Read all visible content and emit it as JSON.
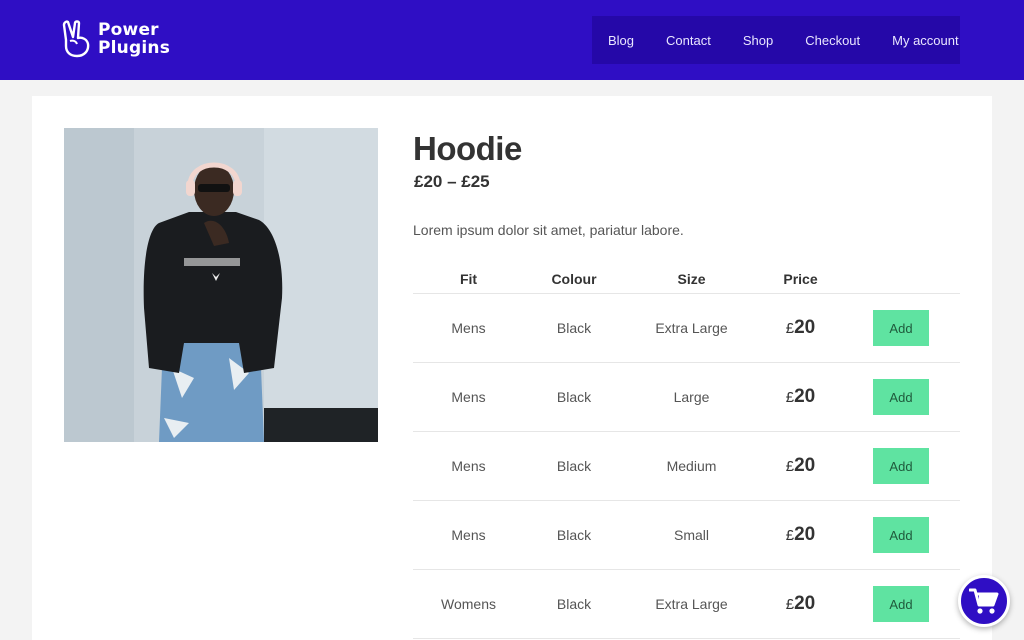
{
  "brand": {
    "line1": "Power",
    "line2": "Plugins"
  },
  "nav": [
    "Blog",
    "Contact",
    "Shop",
    "Checkout",
    "My account"
  ],
  "product": {
    "title": "Hoodie",
    "price_range": "£20 – £25",
    "description": "Lorem ipsum dolor sit amet, pariatur labore.",
    "image_alt": "Model wearing black hoodie"
  },
  "table": {
    "headers": {
      "fit": "Fit",
      "colour": "Colour",
      "size": "Size",
      "price": "Price"
    },
    "rows": [
      {
        "fit": "Mens",
        "colour": "Black",
        "size": "Extra Large",
        "currency": "£",
        "price": "20",
        "action": "Add"
      },
      {
        "fit": "Mens",
        "colour": "Black",
        "size": "Large",
        "currency": "£",
        "price": "20",
        "action": "Add"
      },
      {
        "fit": "Mens",
        "colour": "Black",
        "size": "Medium",
        "currency": "£",
        "price": "20",
        "action": "Add"
      },
      {
        "fit": "Mens",
        "colour": "Black",
        "size": "Small",
        "currency": "£",
        "price": "20",
        "action": "Add"
      },
      {
        "fit": "Womens",
        "colour": "Black",
        "size": "Extra Large",
        "currency": "£",
        "price": "20",
        "action": "Add"
      }
    ]
  },
  "icons": {
    "logo": "peace-hand-icon",
    "cart": "shopping-cart-icon"
  },
  "colors": {
    "header": "#2f0ec4",
    "nav_bg": "#2508a8",
    "add_button": "#5fe3a1"
  }
}
